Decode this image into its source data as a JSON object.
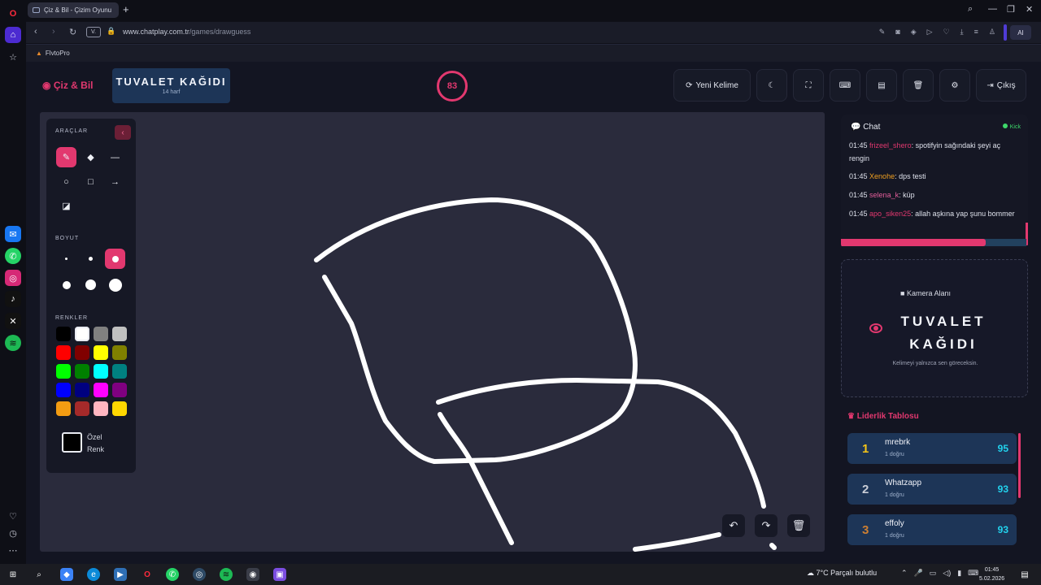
{
  "browser": {
    "tab_title": "Çiz & Bil - Çizim Oyunu",
    "new_tab": "+",
    "url_domain": "www.chatplay.com.tr",
    "url_path": "/games/drawguess",
    "address_pill": "V.",
    "ai_label": "AI",
    "bookmark": "FlvtoPro",
    "win_min": "—",
    "win_max": "❐",
    "win_close": "✕"
  },
  "header": {
    "logo": "Çiz & Bil",
    "word": "TUVALET KAĞIDI",
    "word_hint": "14 harf",
    "timer": "83",
    "new_word": "Yeni Kelime",
    "exit": "Çıkış"
  },
  "tools": {
    "title": "ARAÇLAR",
    "size_title": "BOYUT",
    "colors_title": "RENKLER",
    "custom_label_1": "Özel",
    "custom_label_2": "Renk",
    "palette": [
      "#000000",
      "#ffffff",
      "#808080",
      "#c0c0c0",
      "#ff0000",
      "#800000",
      "#ffff00",
      "#808000",
      "#00ff00",
      "#008000",
      "#00ffff",
      "#008080",
      "#0000ff",
      "#000080",
      "#ff00ff",
      "#800080",
      "#f39c12",
      "#a52a2a",
      "#ffb6c1",
      "#ffd700"
    ],
    "accent": "#e2386f"
  },
  "chat": {
    "title": "Chat",
    "platform": "Kick",
    "messages": [
      {
        "time": "01:45",
        "user": "frizeel_shero",
        "color": "#e2386f",
        "text": "spotifyin sağındaki şeyi aç rengin"
      },
      {
        "time": "01:45",
        "user": "Xenohe",
        "color": "#f0a020",
        "text": "dps testi"
      },
      {
        "time": "01:45",
        "user": "selena_k",
        "color": "#e35d9a",
        "text": "küp"
      },
      {
        "time": "01:45",
        "user": "apo_siken25",
        "color": "#e2386f",
        "text": "allah aşkına yap şunu bommer"
      }
    ],
    "round_progress": 0.78
  },
  "camera": {
    "title": "Kamera Alanı",
    "word_line1": "TUVALET",
    "word_line2": "KAĞIDI",
    "note": "Kelimeyi yalnızca sen göreceksin."
  },
  "leaderboard": {
    "title": "Liderlik Tablosu",
    "rows": [
      {
        "rank": "1",
        "name": "mrebrk",
        "sub": "1 doğru",
        "score": "95",
        "rank_color": "#f5c518"
      },
      {
        "rank": "2",
        "name": "Whatzapp",
        "sub": "1 doğru",
        "score": "93",
        "rank_color": "#c9cdd6"
      },
      {
        "rank": "3",
        "name": "effoly",
        "sub": "1 doğru",
        "score": "93",
        "rank_color": "#cd7f32"
      }
    ]
  },
  "taskbar": {
    "weather": "7°C  Parçalı bulutlu",
    "time": "01:45",
    "date": "5.02.2026"
  }
}
